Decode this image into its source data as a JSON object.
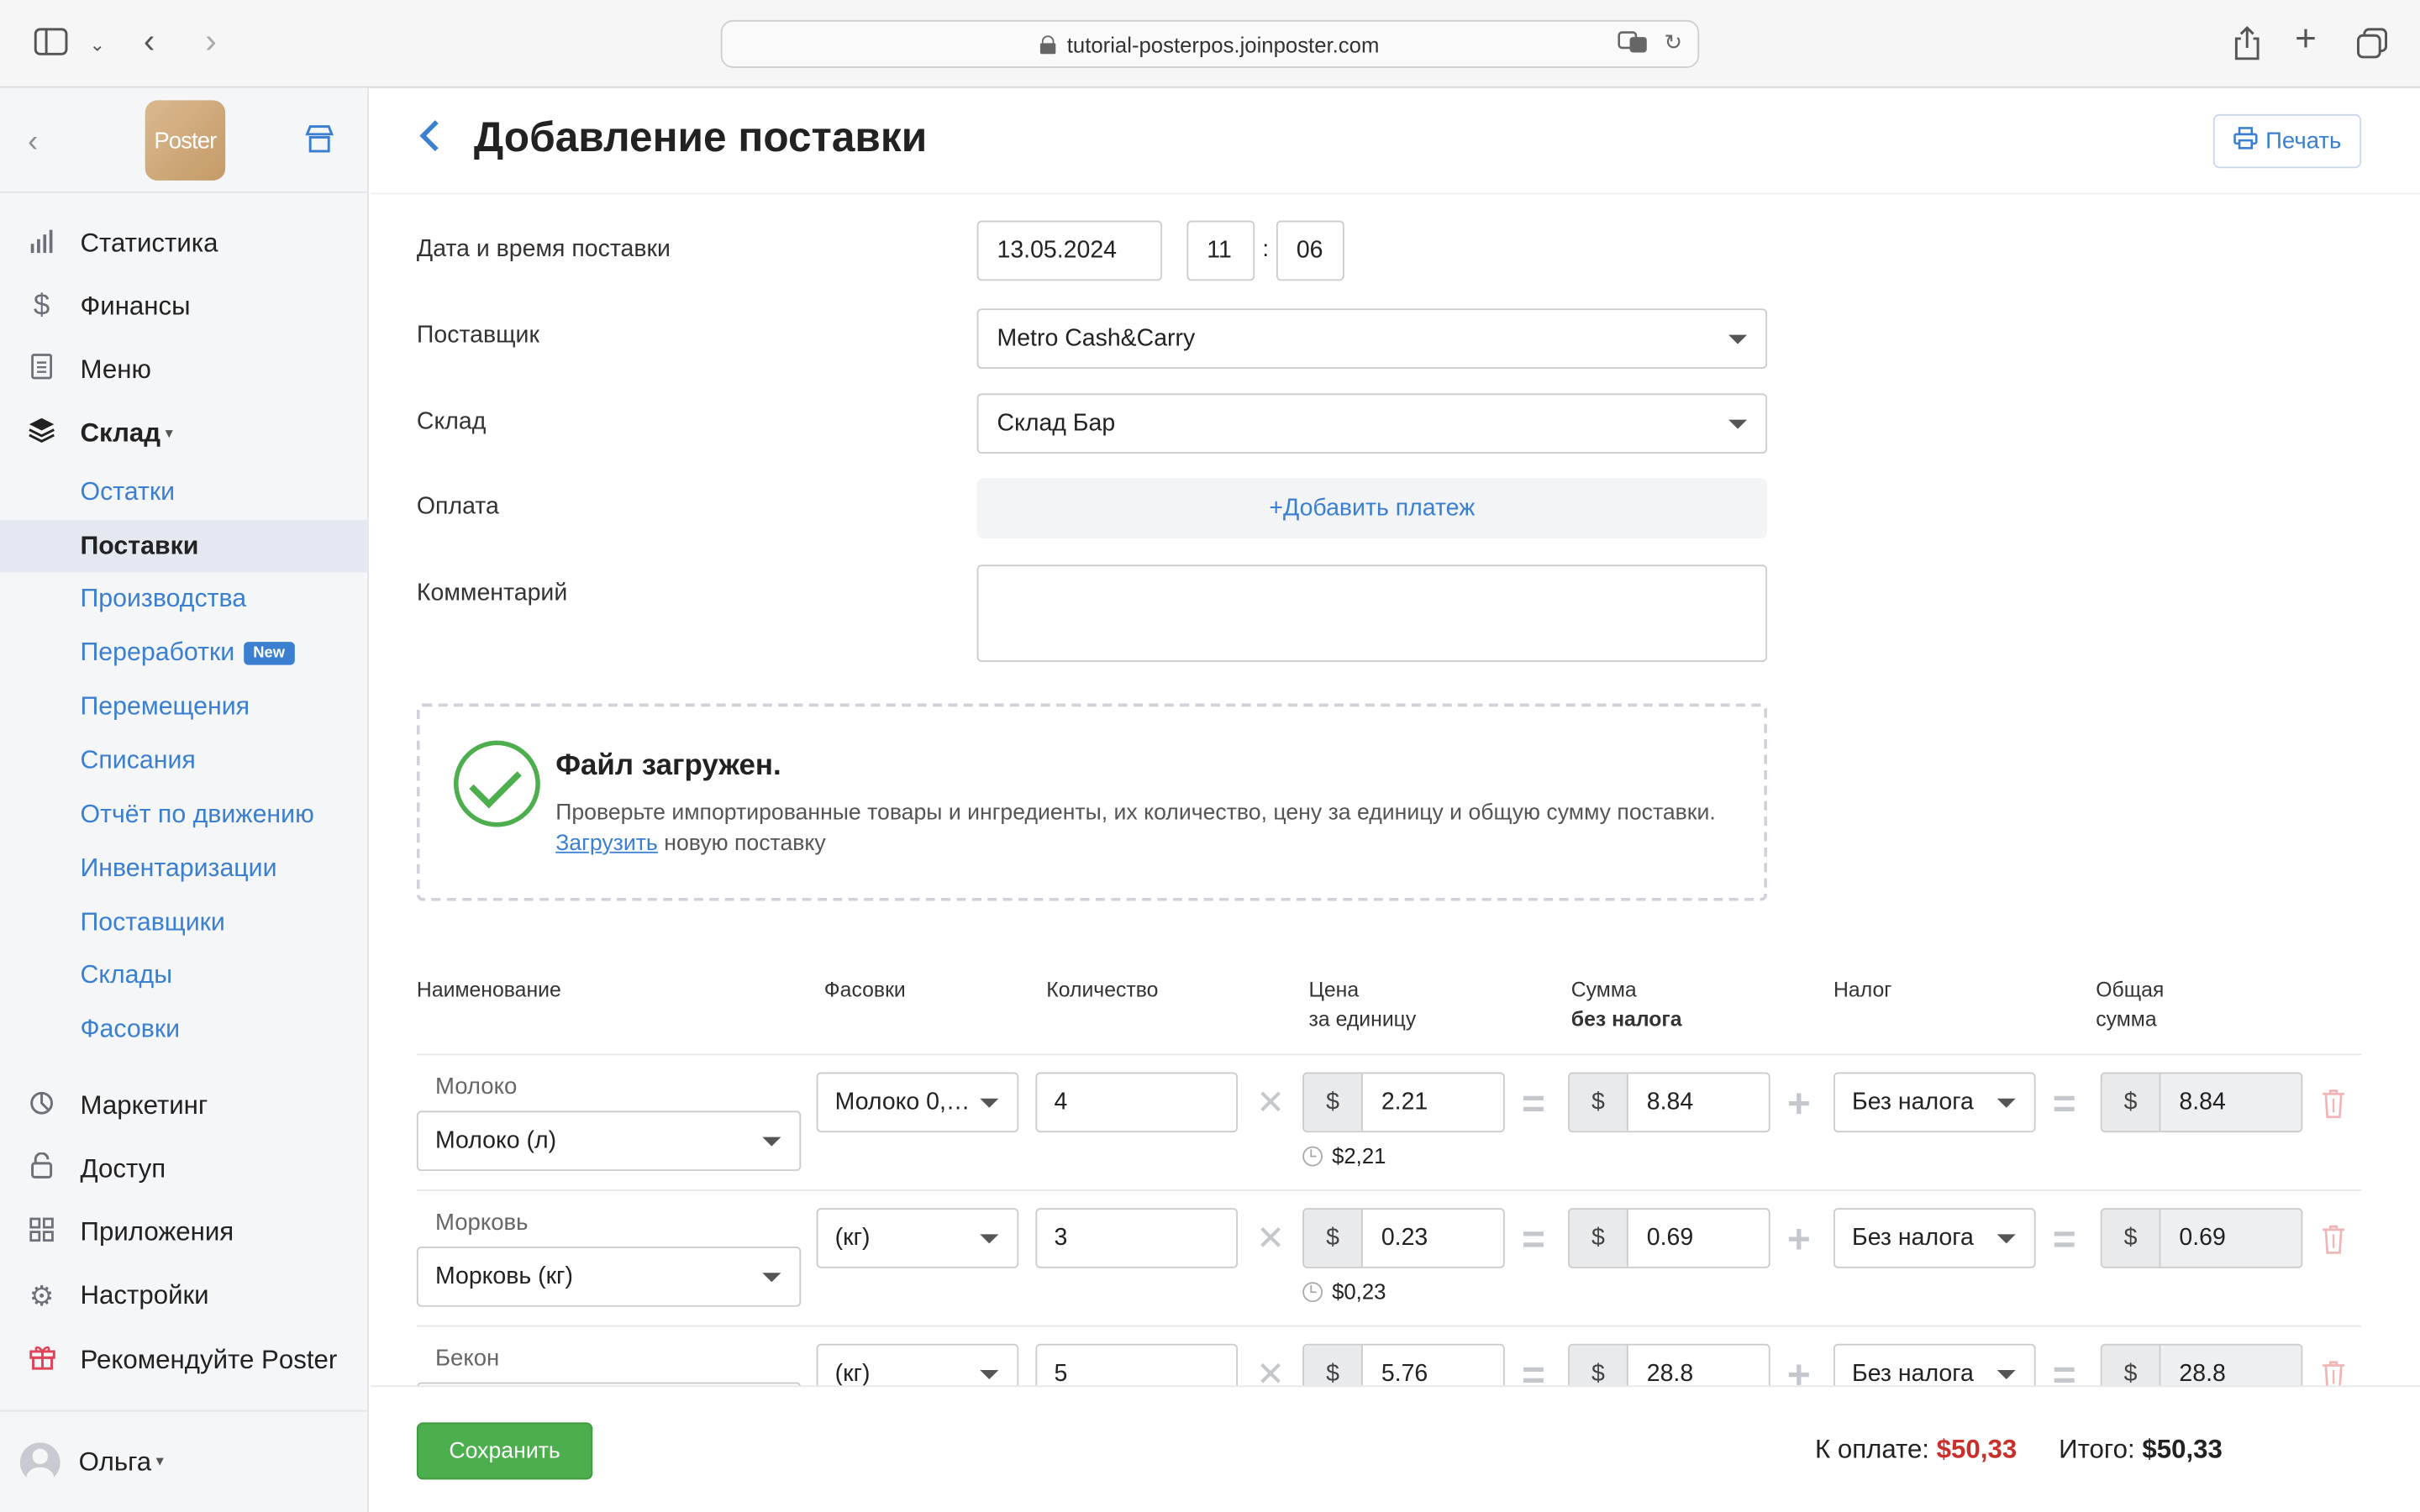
{
  "browser": {
    "url": "tutorial-posterpos.joinposter.com"
  },
  "sidebar": {
    "logo": "Poster",
    "main_items": [
      {
        "label": "Статистика",
        "icon": "chart-bars-icon"
      },
      {
        "label": "Финансы",
        "icon": "dollar-icon"
      },
      {
        "label": "Меню",
        "icon": "document-icon"
      },
      {
        "label": "Склад",
        "icon": "layers-icon"
      }
    ],
    "sklad_caret": "▾",
    "sub_items": [
      {
        "label": "Остатки"
      },
      {
        "label": "Поставки",
        "active": true
      },
      {
        "label": "Производства"
      },
      {
        "label": "Переработки",
        "badge": "New"
      },
      {
        "label": "Перемещения"
      },
      {
        "label": "Списания"
      },
      {
        "label": "Отчёт по движению"
      },
      {
        "label": "Инвентаризации"
      },
      {
        "label": "Поставщики"
      },
      {
        "label": "Склады"
      },
      {
        "label": "Фасовки"
      }
    ],
    "bottom_items": [
      {
        "label": "Маркетинг",
        "icon": "marketing-icon"
      },
      {
        "label": "Доступ",
        "icon": "lock-icon"
      },
      {
        "label": "Приложения",
        "icon": "grid-icon"
      },
      {
        "label": "Настройки",
        "icon": "gear-icon"
      },
      {
        "label": "Рекомендуйте Poster",
        "icon": "gift-icon"
      }
    ],
    "user": "Ольга",
    "user_caret": "▾"
  },
  "header": {
    "title": "Добавление поставки",
    "print_label": "Печать"
  },
  "form": {
    "date_label": "Дата и время поставки",
    "date_value": "13.05.2024",
    "hour_value": "11",
    "time_sep": ":",
    "minute_value": "06",
    "supplier_label": "Поставщик",
    "supplier_value": "Metro Cash&Carry",
    "warehouse_label": "Склад",
    "warehouse_value": "Склад Бар",
    "payment_label": "Оплата",
    "add_payment": "+Добавить платеж",
    "comment_label": "Комментарий"
  },
  "upload": {
    "title": "Файл загружен.",
    "text": "Проверьте импортированные товары и ингредиенты, их количество, цену за единицу и общую сумму поставки.",
    "link": "Загрузить",
    "link_suffix": " новую поставку"
  },
  "table": {
    "headers": {
      "name": "Наименование",
      "packing": "Фасовки",
      "quantity": "Количество",
      "price_1": "Цена",
      "price_2": "за единицу",
      "sum_1": "Сумма",
      "sum_2": "без налога",
      "tax": "Налог",
      "total_1": "Общая",
      "total_2": "сумма"
    },
    "currency": "$",
    "op_times": "✕",
    "op_eq": "=",
    "op_plus": "+",
    "rows": [
      {
        "name": "Молоко",
        "ingredient": "Молоко (л)",
        "packing": "Молоко 0,…",
        "qty": "4",
        "price": "2.21",
        "hint": "$2,21",
        "sum": "8.84",
        "tax": "Без налога",
        "total": "8.84"
      },
      {
        "name": "Морковь",
        "ingredient": "Морковь (кг)",
        "packing": "(кг)",
        "qty": "3",
        "price": "0.23",
        "hint": "$0,23",
        "sum": "0.69",
        "tax": "Без налога",
        "total": "0.69"
      },
      {
        "name": "Бекон",
        "ingredient": "",
        "packing": "(кг)",
        "qty": "5",
        "price": "5.76",
        "hint": "",
        "sum": "28.8",
        "tax": "Без налога",
        "total": "28.8"
      }
    ]
  },
  "footer": {
    "save_label": "Сохранить",
    "to_pay_label": "К оплате:",
    "to_pay_value": "$50,33",
    "total_label": "Итого:",
    "total_value": "$50,33"
  },
  "colors": {
    "accent": "#3b7fd0",
    "save_green": "#4cae4c",
    "pay_red": "#c9302c"
  }
}
